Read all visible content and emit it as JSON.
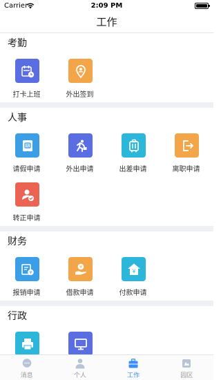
{
  "status": {
    "carrier": "Carrier",
    "time": "2:09 PM"
  },
  "nav": {
    "title": "工作"
  },
  "sections": [
    {
      "title": "考勤",
      "items": [
        {
          "label": "打卡上班",
          "icon": "calendar-clock-icon",
          "color": "#5b6ee1"
        },
        {
          "label": "外出签到",
          "icon": "location-pin-icon",
          "color": "#f3a54a"
        }
      ]
    },
    {
      "title": "人事",
      "items": [
        {
          "label": "请假申请",
          "icon": "leave-form-icon",
          "color": "#3c9ee6"
        },
        {
          "label": "外出申请",
          "icon": "running-person-icon",
          "color": "#5b6ee1"
        },
        {
          "label": "出差申请",
          "icon": "suitcase-icon",
          "color": "#2cb6d9"
        },
        {
          "label": "离职申请",
          "icon": "exit-door-icon",
          "color": "#f3a54a"
        },
        {
          "label": "转正申请",
          "icon": "user-check-icon",
          "color": "#ea6353"
        }
      ]
    },
    {
      "title": "财务",
      "items": [
        {
          "label": "报销申请",
          "icon": "receipt-icon",
          "color": "#3c9ee6"
        },
        {
          "label": "借款申请",
          "icon": "hand-coin-icon",
          "color": "#f3a54a"
        },
        {
          "label": "付款申请",
          "icon": "yen-house-icon",
          "color": "#2cb6d9"
        }
      ]
    },
    {
      "title": "行政",
      "items": [
        {
          "label": "",
          "icon": "printer-icon",
          "color": "#2cb6d9"
        },
        {
          "label": "",
          "icon": "monitor-icon",
          "color": "#5b6ee1"
        }
      ]
    }
  ],
  "tabs": [
    {
      "label": "消息",
      "icon": "chat-bubble-icon",
      "active": false
    },
    {
      "label": "个人",
      "icon": "person-icon",
      "active": false
    },
    {
      "label": "工作",
      "icon": "briefcase-icon",
      "active": true
    },
    {
      "label": "园区",
      "icon": "park-icon",
      "active": false
    }
  ]
}
